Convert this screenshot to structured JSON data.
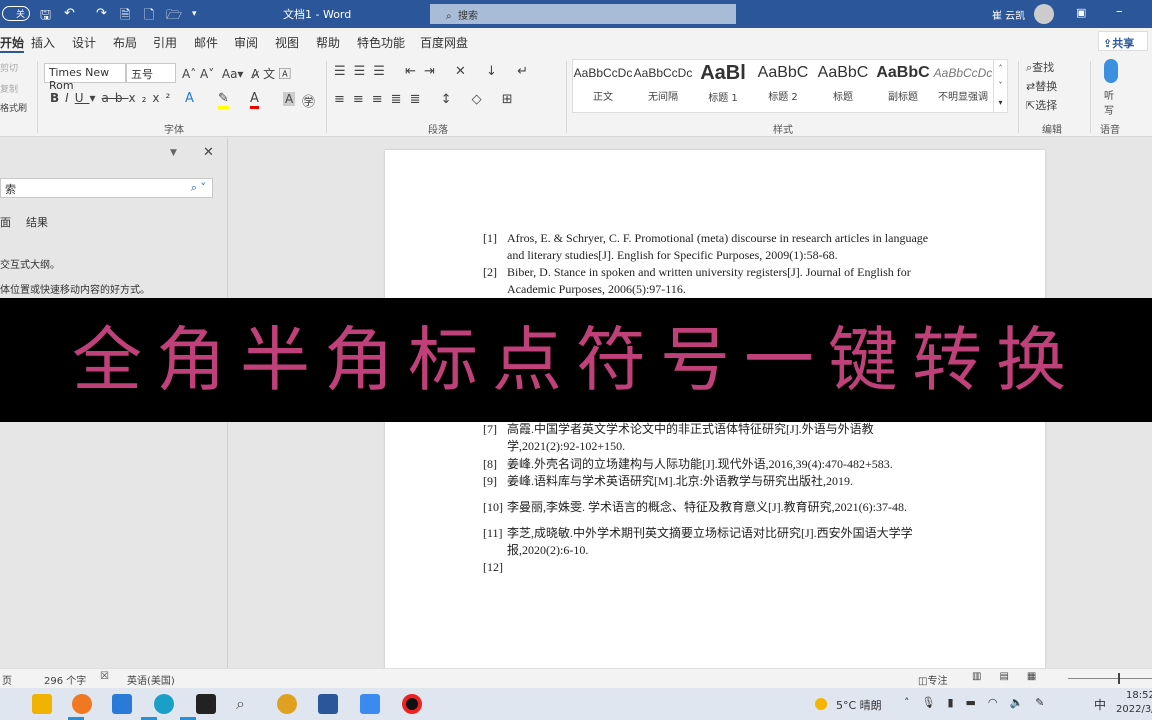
{
  "titlebar": {
    "autosave": "关",
    "title": "文档1 - Word",
    "search_placeholder": "搜索",
    "user": "崔 云凯"
  },
  "tabs": [
    "开始",
    "插入",
    "设计",
    "布局",
    "引用",
    "邮件",
    "审阅",
    "视图",
    "帮助",
    "特色功能",
    "百度网盘"
  ],
  "share": "共享",
  "ribbon": {
    "clipboard": [
      "剪切",
      "复制",
      "格式刷"
    ],
    "font_name": "Times New Rom",
    "font_size": "五号",
    "font_group": "字体",
    "paragraph_group": "段落",
    "styles": [
      {
        "sample": "AaBbCcDc",
        "label": "正文"
      },
      {
        "sample": "AaBbCcDc",
        "label": "无间隔"
      },
      {
        "sample": "AaBl",
        "label": "标题 1"
      },
      {
        "sample": "AaBbC",
        "label": "标题 2"
      },
      {
        "sample": "AaBbC",
        "label": "标题"
      },
      {
        "sample": "AaBbC",
        "label": "副标题"
      },
      {
        "sample": "AaBbCcDc",
        "label": "不明显强调"
      }
    ],
    "styles_group": "样式",
    "editing": [
      "查找",
      "替换",
      "选择"
    ],
    "editing_group": "编辑",
    "dictate": "听写",
    "voice_group": "语音"
  },
  "nav": {
    "search_placeholder": "索",
    "tabs": [
      "面",
      "结果"
    ],
    "hint1": "交互式大纲。",
    "hint2": "体位置或快速移动内容的好方式。"
  },
  "document": {
    "references": [
      {
        "n": "[1]",
        "text": "Afros, E. & Schryer, C. F. Promotional (meta) discourse in research articles in language and literary studies[J]. English for Specific Purposes, 2009(1):58-68."
      },
      {
        "n": "[2]",
        "text": "Biber, D. Stance in spoken and written university registers[J]. Journal of English for Academic Purposes, 2006(5):97-116."
      },
      {
        "n": "[7]",
        "text": "高霞.中国学者英文学术论文中的非正式语体特征研究[J].外语与外语教学,2021(2):92-102+150."
      },
      {
        "n": "[8]",
        "text": "姜峰.外壳名词的立场建构与人际功能[J].现代外语,2016,39(4):470-482+583."
      },
      {
        "n": "[9]",
        "text": "姜峰.语料库与学术英语研究[M].北京:外语教学与研究出版社,2019."
      },
      {
        "n": "[10]",
        "text": "李曼丽,李姝雯. 学术语言的概念、特征及教育意义[J].教育研究,2021(6):37-48."
      },
      {
        "n": "[11]",
        "text": "李芝,成晓敏.中外学术期刊英文摘要立场标记语对比研究[J].西安外国语大学学报,2020(2):6-10."
      },
      {
        "n": "[12]",
        "text": ""
      }
    ]
  },
  "banner": "全角半角标点符号一键转换",
  "status": {
    "page": "页",
    "words": "296 个字",
    "language": "英语(美国)",
    "focus": "专注"
  },
  "taskbar": {
    "weather": "5°C 晴朗",
    "ime": "中",
    "time": "18:52",
    "date": "2022/3/"
  },
  "colors": {
    "title_bar": "#2b579a",
    "banner_text": "#c0407a"
  }
}
